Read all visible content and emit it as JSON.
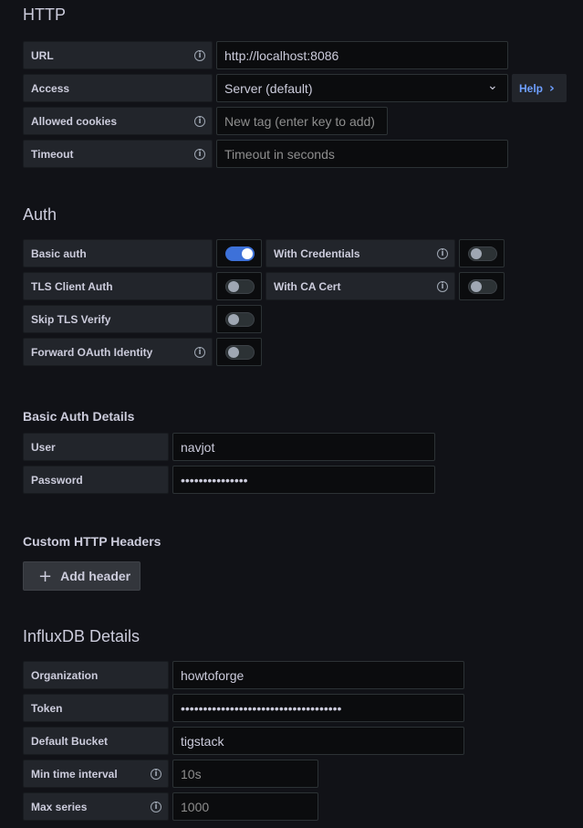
{
  "http": {
    "title": "HTTP",
    "url_label": "URL",
    "url_value": "http://localhost:8086",
    "access_label": "Access",
    "access_value": "Server (default)",
    "help_label": "Help",
    "cookies_label": "Allowed cookies",
    "cookies_placeholder": "New tag (enter key to add)",
    "timeout_label": "Timeout",
    "timeout_placeholder": "Timeout in seconds"
  },
  "auth": {
    "title": "Auth",
    "basic_auth_label": "Basic auth",
    "basic_auth_on": true,
    "with_credentials_label": "With Credentials",
    "with_credentials_on": false,
    "tls_client_auth_label": "TLS Client Auth",
    "tls_client_auth_on": false,
    "with_ca_cert_label": "With CA Cert",
    "with_ca_cert_on": false,
    "skip_tls_label": "Skip TLS Verify",
    "skip_tls_on": false,
    "forward_oauth_label": "Forward OAuth Identity",
    "forward_oauth_on": false
  },
  "basic_auth_details": {
    "title": "Basic Auth Details",
    "user_label": "User",
    "user_value": "navjot",
    "password_label": "Password",
    "password_value": "•••••••••••••••"
  },
  "custom_headers": {
    "title": "Custom HTTP Headers",
    "add_button": "Add header",
    "add_icon": "+"
  },
  "influx": {
    "title": "InfluxDB Details",
    "org_label": "Organization",
    "org_value": "howtoforge",
    "token_label": "Token",
    "token_value": "••••••••••••••••••••••••••••••••••••",
    "bucket_label": "Default Bucket",
    "bucket_value": "tigstack",
    "min_interval_label": "Min time interval",
    "min_interval_placeholder": "10s",
    "max_series_label": "Max series",
    "max_series_placeholder": "1000"
  },
  "icons": {
    "info": "i",
    "chevron_down": "⌄",
    "chevron_right": "›"
  },
  "colors": {
    "background": "#111217",
    "accent": "#3d71d9",
    "link": "#6e9fff"
  }
}
